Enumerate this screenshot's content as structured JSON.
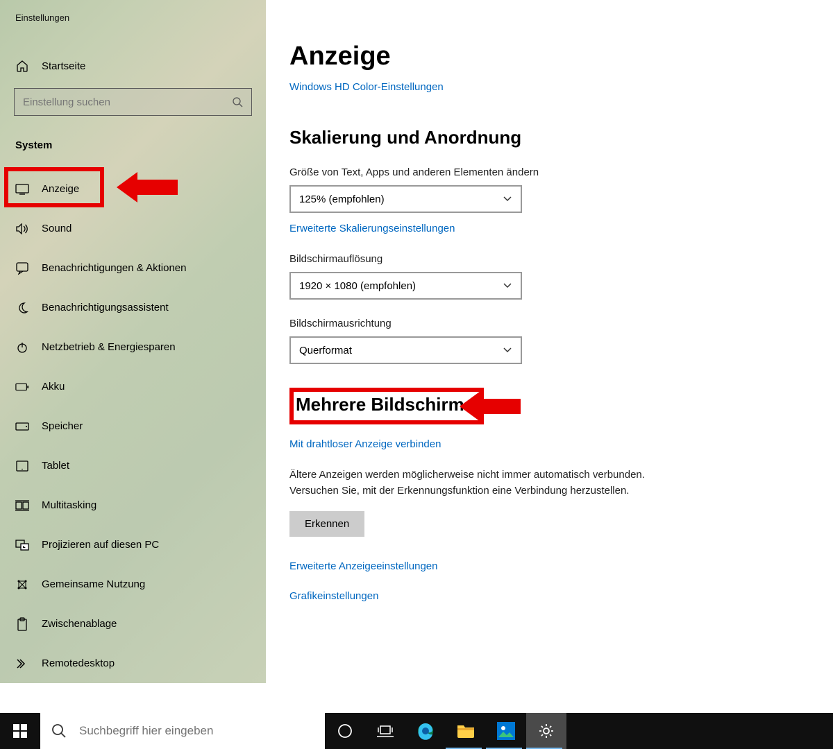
{
  "window_title": "Einstellungen",
  "sidebar": {
    "home": "Startseite",
    "search_placeholder": "Einstellung suchen",
    "category": "System",
    "items": [
      {
        "label": "Anzeige",
        "icon": "display"
      },
      {
        "label": "Sound",
        "icon": "sound"
      },
      {
        "label": "Benachrichtigungen & Aktionen",
        "icon": "notifications"
      },
      {
        "label": "Benachrichtigungsassistent",
        "icon": "focus"
      },
      {
        "label": "Netzbetrieb & Energiesparen",
        "icon": "power"
      },
      {
        "label": "Akku",
        "icon": "battery"
      },
      {
        "label": "Speicher",
        "icon": "storage"
      },
      {
        "label": "Tablet",
        "icon": "tablet"
      },
      {
        "label": "Multitasking",
        "icon": "multitask"
      },
      {
        "label": "Projizieren auf diesen PC",
        "icon": "project"
      },
      {
        "label": "Gemeinsame Nutzung",
        "icon": "share"
      },
      {
        "label": "Zwischenablage",
        "icon": "clipboard"
      },
      {
        "label": "Remotedesktop",
        "icon": "remote"
      }
    ]
  },
  "main": {
    "title": "Anzeige",
    "hdcolor_link": "Windows HD Color-Einstellungen",
    "scaling_heading": "Skalierung und Anordnung",
    "scale_label": "Größe von Text, Apps und anderen Elementen ändern",
    "scale_value": "125% (empfohlen)",
    "adv_scale_link": "Erweiterte Skalierungseinstellungen",
    "res_label": "Bildschirmauflösung",
    "res_value": "1920 × 1080 (empfohlen)",
    "orient_label": "Bildschirmausrichtung",
    "orient_value": "Querformat",
    "multi_heading": "Mehrere Bildschirme",
    "wireless_link": "Mit drahtloser Anzeige verbinden",
    "detect_text": "Ältere Anzeigen werden möglicherweise nicht immer automatisch verbunden. Versuchen Sie, mit der Erkennungsfunktion eine Verbindung herzustellen.",
    "detect_button": "Erkennen",
    "adv_display_link": "Erweiterte Anzeigeeinstellungen",
    "graphics_link": "Grafikeinstellungen"
  },
  "taskbar": {
    "search_placeholder": "Suchbegriff hier eingeben"
  },
  "annotations": {
    "highlight1": "Anzeige sidebar item",
    "highlight2": "Mehrere Bildschirme heading"
  }
}
